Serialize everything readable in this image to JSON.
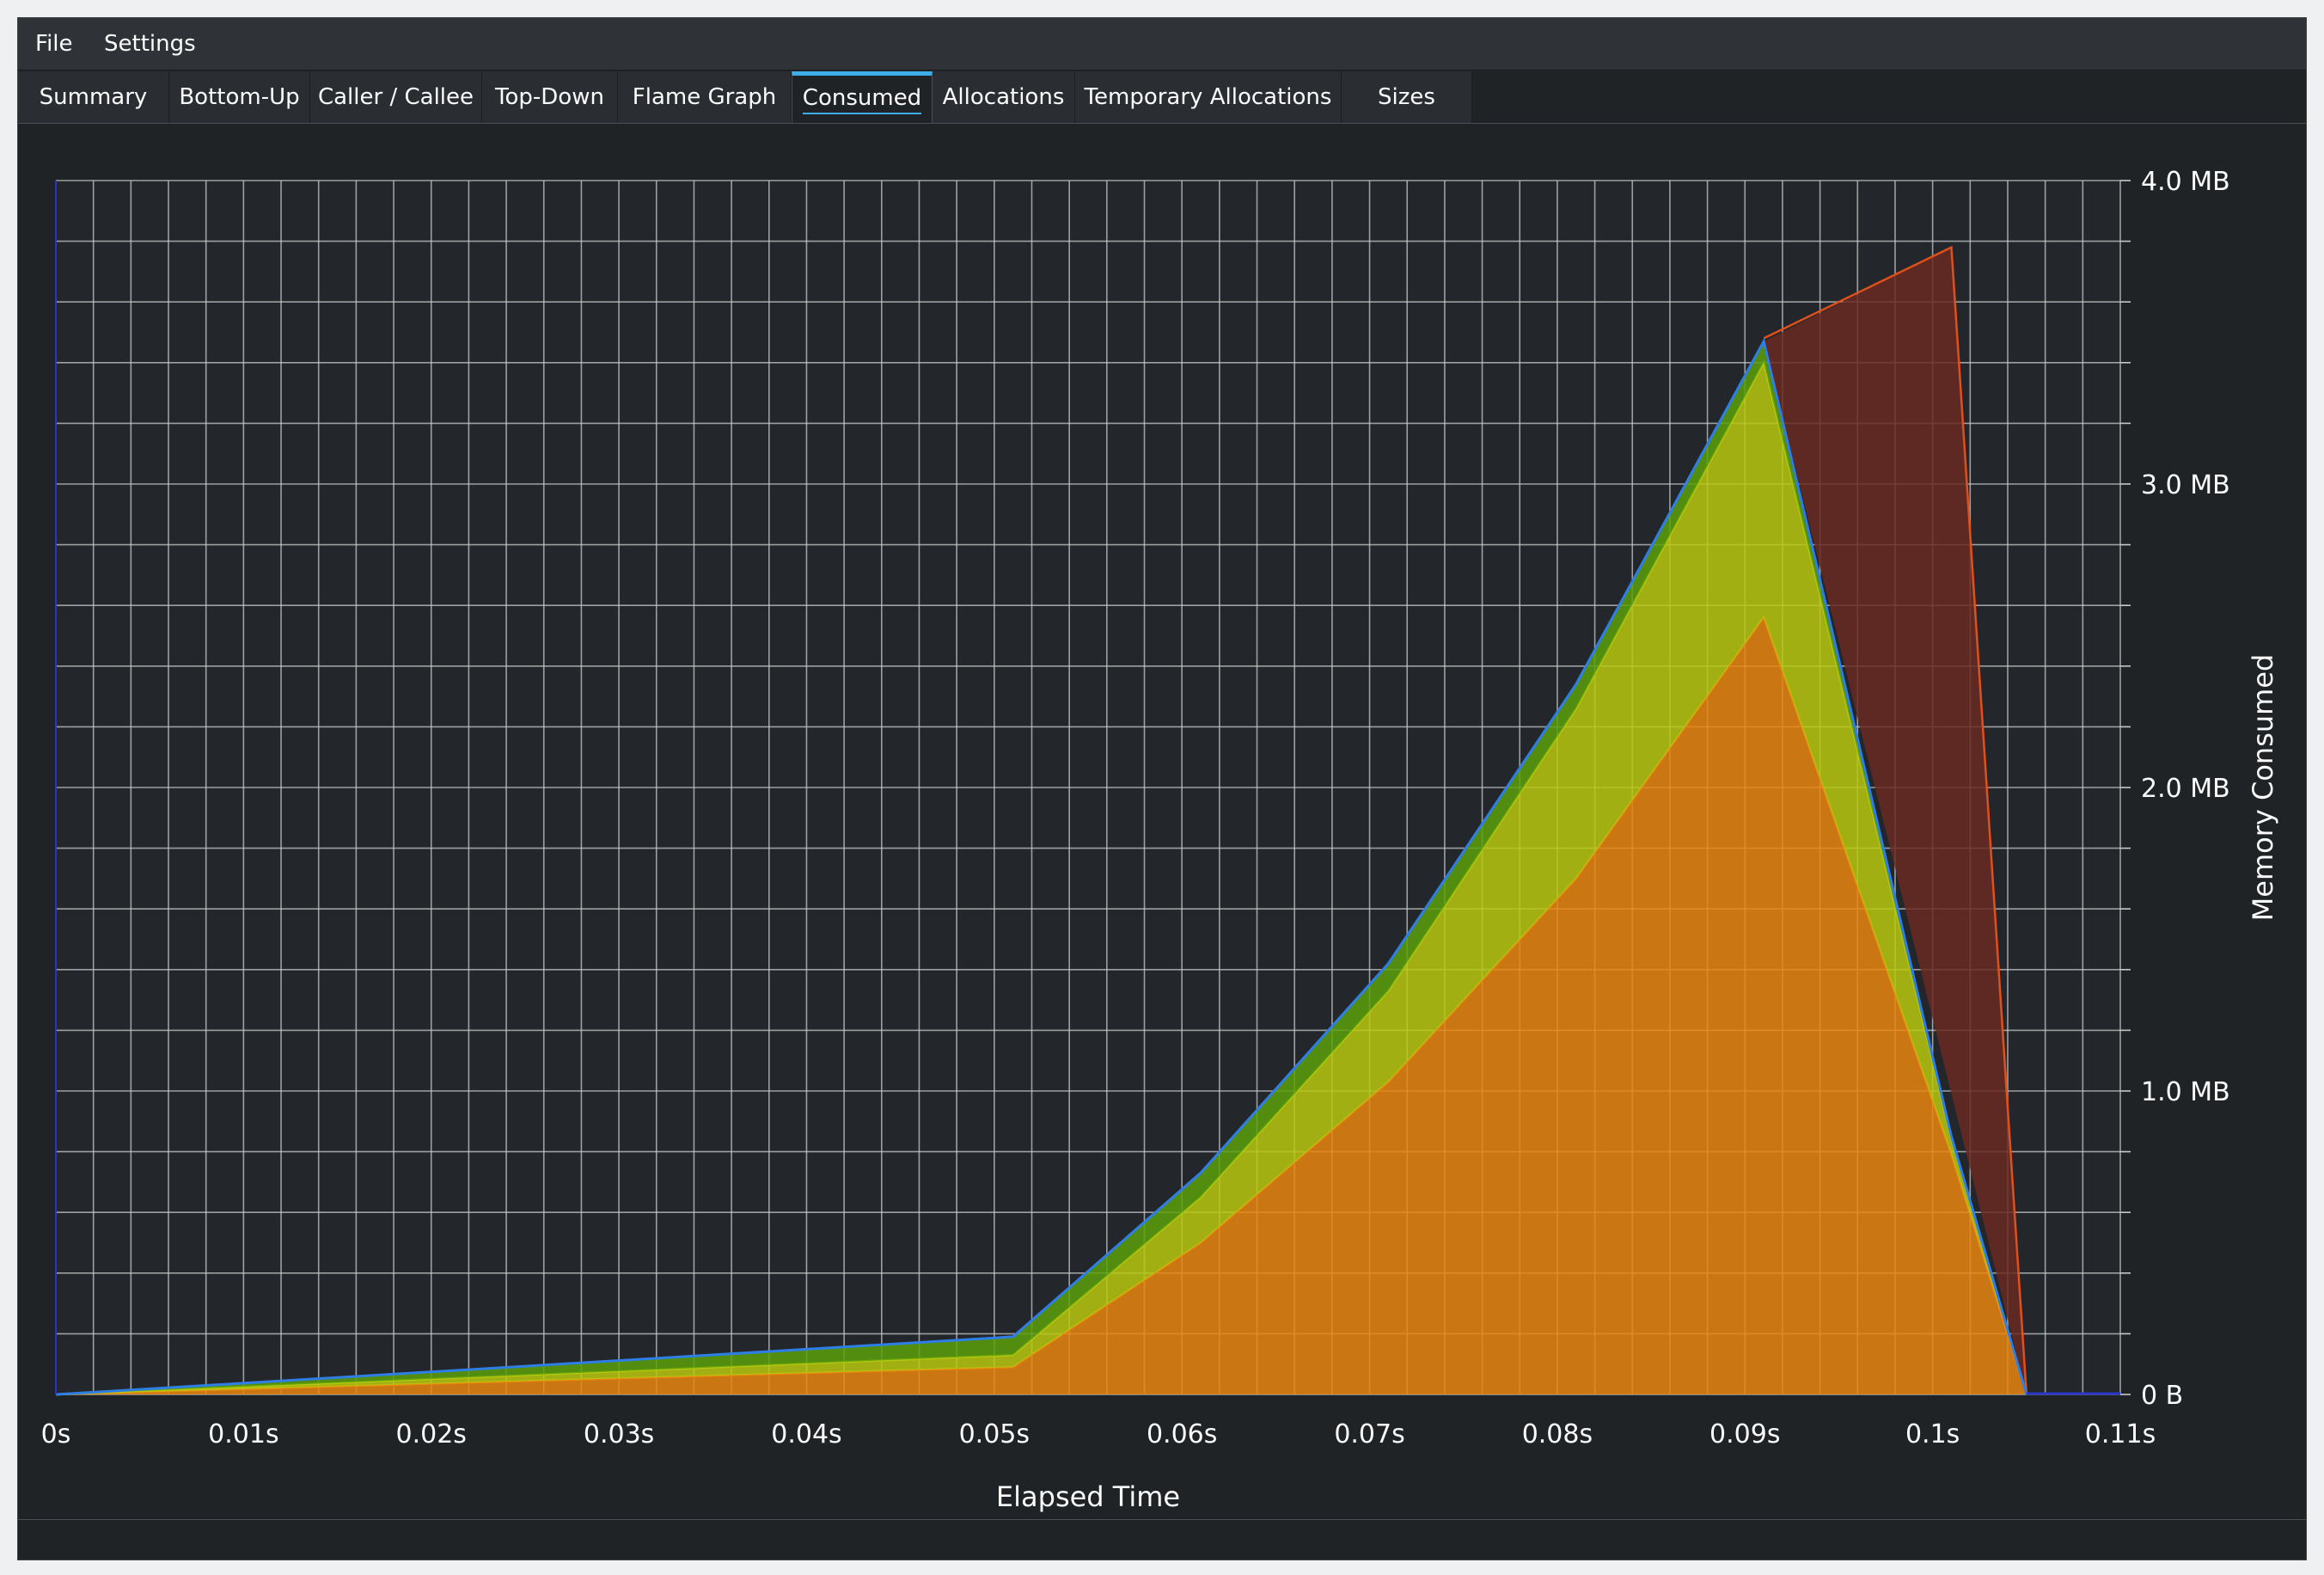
{
  "menu": {
    "file": "File",
    "settings": "Settings"
  },
  "tabs": [
    {
      "label": "Summary"
    },
    {
      "label": "Bottom-Up"
    },
    {
      "label": "Caller / Callee"
    },
    {
      "label": "Top-Down"
    },
    {
      "label": "Flame Graph"
    },
    {
      "label": "Consumed",
      "active": true
    },
    {
      "label": "Allocations"
    },
    {
      "label": "Temporary Allocations"
    },
    {
      "label": "Sizes"
    }
  ],
  "colors": {
    "accent": "#3daee9",
    "grid": "#c8c8c8",
    "background": "#23262a"
  },
  "chart_data": {
    "type": "area",
    "stacked": true,
    "xlabel": "Elapsed Time",
    "ylabel": "Memory Consumed",
    "x_unit": "s",
    "y_unit": "MB",
    "xlim": [
      0,
      0.11
    ],
    "ylim": [
      0,
      4.0
    ],
    "x_ticks": [
      "0s",
      "0.01s",
      "0.02s",
      "0.03s",
      "0.04s",
      "0.05s",
      "0.06s",
      "0.07s",
      "0.08s",
      "0.09s",
      "0.1s",
      "0.11s"
    ],
    "y_ticks": [
      "0 B",
      "1.0 MB",
      "2.0 MB",
      "3.0 MB",
      "4.0 MB"
    ],
    "grid": true,
    "y_axis_position": "right",
    "series": [
      {
        "color": "#e8850f",
        "x": [
          0,
          0.051,
          0.061,
          0.071,
          0.081,
          0.091,
          0.101,
          0.105
        ],
        "values": [
          0,
          0.09,
          0.5,
          1.03,
          1.7,
          2.56,
          0.79,
          0
        ]
      },
      {
        "color": "#b7c80f",
        "x": [
          0,
          0.051,
          0.061,
          0.071,
          0.081,
          0.091,
          0.101,
          0.105
        ],
        "values": [
          0,
          0.04,
          0.15,
          0.3,
          0.56,
          0.84,
          0.05,
          0
        ]
      },
      {
        "color": "#5aa00a",
        "x": [
          0,
          0.051,
          0.061,
          0.071,
          0.081,
          0.091,
          0.101,
          0.105
        ],
        "values": [
          0,
          0.06,
          0.08,
          0.09,
          0.08,
          0.07,
          0.01,
          0
        ]
      },
      {
        "color": "#6a2a22",
        "x": [
          0.091,
          0.101,
          0.105
        ],
        "values": [
          3.48,
          3.78,
          0
        ]
      }
    ]
  }
}
